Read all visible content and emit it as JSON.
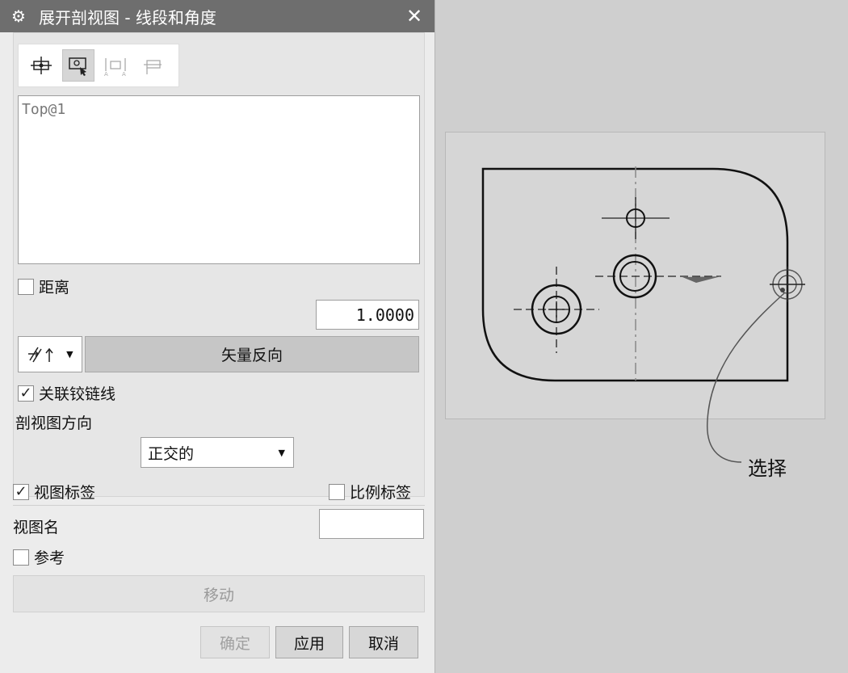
{
  "dialog": {
    "title": "展开剖视图 - 线段和角度",
    "icons": {
      "settings": "gear-icon",
      "close": "close-icon"
    },
    "toolbar": {
      "buttons": [
        {
          "icon": "section-line-icon",
          "active": false
        },
        {
          "icon": "select-view-icon",
          "active": true
        },
        {
          "icon": "dimension-a-icon",
          "active": false
        },
        {
          "icon": "segment-icon",
          "active": false
        }
      ]
    },
    "list": {
      "items": [
        "Top@1"
      ]
    },
    "distance": {
      "label": "距离",
      "checked": false,
      "value": "1.0000"
    },
    "vector": {
      "dropdown_icon": "vector-direction-icon",
      "reverse_label": "矢量反向"
    },
    "associative_hinge": {
      "label": "关联铰链线",
      "checked": true
    },
    "section_direction": {
      "label": "剖视图方向",
      "selected": "正交的"
    },
    "view_label": {
      "label": "视图标签",
      "checked": true
    },
    "scale_label": {
      "label": "比例标签",
      "checked": false
    },
    "view_name": {
      "label": "视图名",
      "value": ""
    },
    "reference": {
      "label": "参考",
      "checked": false
    },
    "move_label": "移动",
    "buttons": {
      "ok": "确定",
      "apply": "应用",
      "cancel": "取消"
    }
  },
  "graphics": {
    "callout_label": "选择"
  }
}
